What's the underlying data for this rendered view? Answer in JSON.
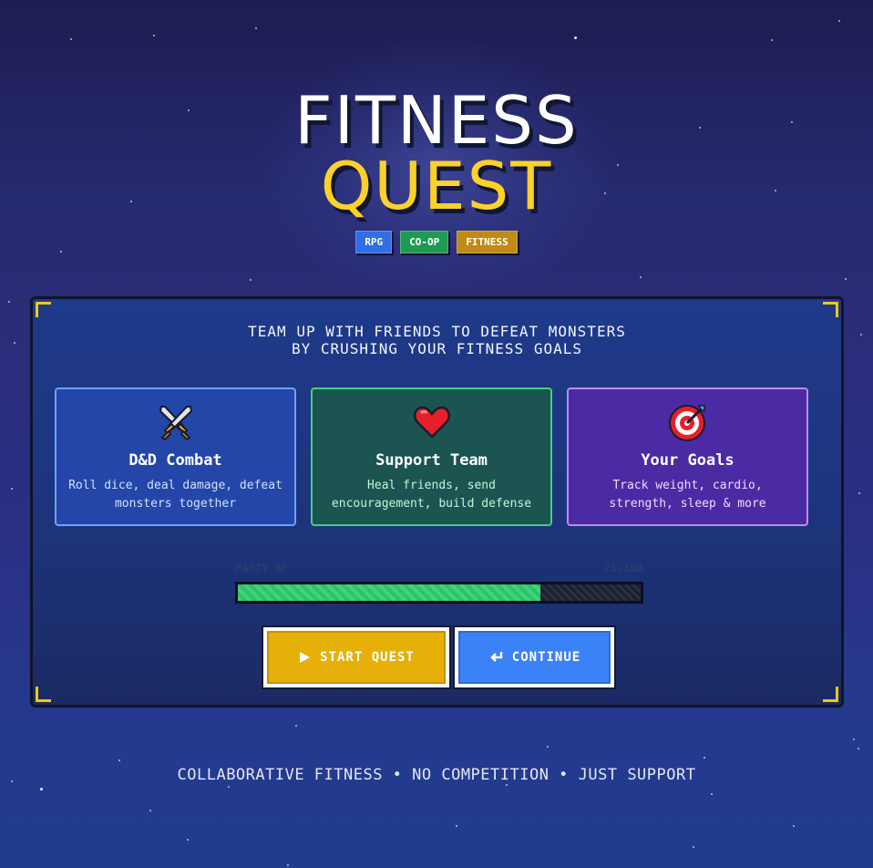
{
  "header": {
    "title_line1": "FITNESS",
    "title_line2": "QUEST",
    "tags": [
      "RPG",
      "CO-OP",
      "FITNESS"
    ]
  },
  "panel": {
    "tagline_line1": "TEAM UP WITH FRIENDS TO DEFEAT MONSTERS",
    "tagline_line2": "BY CRUSHING YOUR FITNESS GOALS",
    "cards": [
      {
        "icon": "crossed-swords-icon",
        "title": "D&D Combat",
        "desc": "Roll dice, deal damage, defeat monsters together"
      },
      {
        "icon": "heart-icon",
        "title": "Support Team",
        "desc": "Heal friends, send encouragement, build defense"
      },
      {
        "icon": "target-icon",
        "title": "Your Goals",
        "desc": "Track weight, cardio, strength, sleep & more"
      }
    ],
    "party_hp": {
      "label": "PARTY HP",
      "value_text": "75/100",
      "fraction": 0.75
    },
    "buttons": {
      "start": "START QUEST",
      "continue": "CONTINUE"
    }
  },
  "footer": {
    "text": "COLLABORATIVE FITNESS • NO COMPETITION • JUST SUPPORT"
  },
  "colors": {
    "accent_gold": "#fcd12a",
    "panel_blue": "#1e3a8a",
    "hp_green": "#3fd47b",
    "continue_blue": "#3b82f6"
  }
}
